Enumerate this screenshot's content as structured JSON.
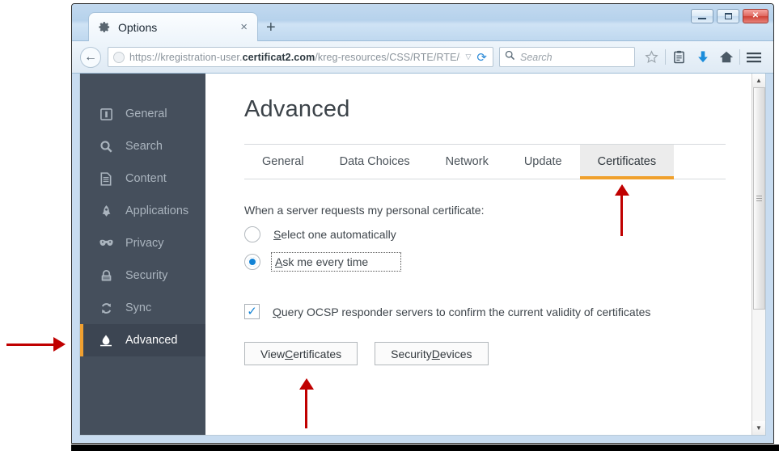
{
  "window": {
    "controls": {
      "minimize": "minimize",
      "maximize": "maximize",
      "close": "✕"
    }
  },
  "browser": {
    "tab": {
      "title": "Options",
      "favicon": "gear-icon",
      "close_label": "×"
    },
    "new_tab_label": "+",
    "back_label": "←",
    "url": {
      "prefix": "https://kregistration-user.",
      "domain": "certificat2.com",
      "suffix": "/kreg-resources/CSS/RTE/RTE/Cer",
      "dropdown": "▽",
      "reload": "⟳"
    },
    "search": {
      "placeholder": "Search",
      "icon": "search-icon"
    },
    "toolbar_icons": [
      "bookmark-star-icon",
      "reading-list-icon",
      "downloads-icon",
      "home-icon",
      "menu-icon"
    ]
  },
  "sidebar": {
    "items": [
      {
        "label": "General",
        "icon": "general-icon",
        "active": false
      },
      {
        "label": "Search",
        "icon": "search-icon",
        "active": false
      },
      {
        "label": "Content",
        "icon": "content-icon",
        "active": false
      },
      {
        "label": "Applications",
        "icon": "applications-icon",
        "active": false
      },
      {
        "label": "Privacy",
        "icon": "privacy-mask-icon",
        "active": false
      },
      {
        "label": "Security",
        "icon": "security-lock-icon",
        "active": false
      },
      {
        "label": "Sync",
        "icon": "sync-icon",
        "active": false
      },
      {
        "label": "Advanced",
        "icon": "advanced-icon",
        "active": true
      }
    ]
  },
  "page": {
    "title": "Advanced",
    "tabs": [
      {
        "label": "General",
        "active": false
      },
      {
        "label": "Data Choices",
        "active": false
      },
      {
        "label": "Network",
        "active": false
      },
      {
        "label": "Update",
        "active": false
      },
      {
        "label": "Certificates",
        "active": true
      }
    ],
    "certificates": {
      "prompt": "When a server requests my personal certificate:",
      "radio_options": [
        {
          "label_pre": "",
          "label_key": "S",
          "label_post": "elect one automatically",
          "selected": false
        },
        {
          "label_pre": "",
          "label_key": "A",
          "label_post": "sk me every time",
          "selected": true,
          "focused": true
        }
      ],
      "checkbox": {
        "checked": true,
        "mark": "✓",
        "label_key": "Q",
        "label_post": "uery OCSP responder servers to confirm the current validity of certificates"
      },
      "buttons": [
        {
          "pre": "View ",
          "key": "C",
          "post": "ertificates"
        },
        {
          "pre": "Security ",
          "key": "D",
          "post": "evices"
        }
      ]
    }
  },
  "scrollbar": {
    "up": "▲",
    "down": "▼"
  },
  "annotations": [
    {
      "name": "arrow-to-advanced-sidebar",
      "direction": "right"
    },
    {
      "name": "arrow-to-certificates-tab",
      "direction": "up"
    },
    {
      "name": "arrow-to-view-certificates-button",
      "direction": "up"
    }
  ],
  "colors": {
    "accent_orange": "#f0a02c",
    "sidebar_bg": "#454f5c",
    "annotation_red": "#c00000",
    "control_blue": "#1283d6"
  }
}
